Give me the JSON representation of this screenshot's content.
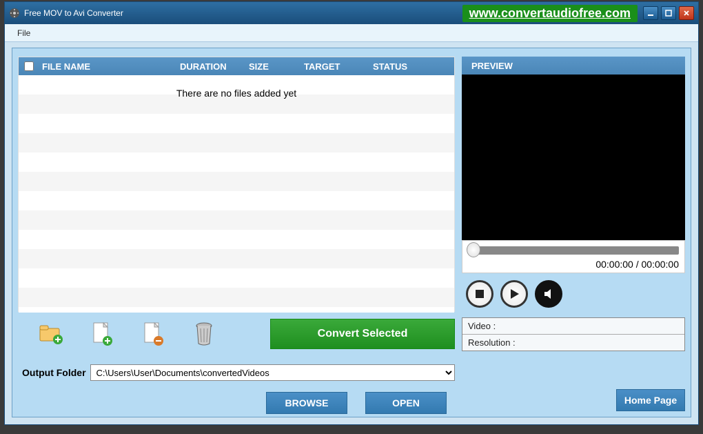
{
  "window": {
    "title": "Free MOV to Avi Converter",
    "promo": "www.convertaudiofree.com"
  },
  "menubar": {
    "file": "File"
  },
  "table": {
    "headers": {
      "name": "FILE NAME",
      "duration": "DURATION",
      "size": "SIZE",
      "target": "TARGET",
      "status": "STATUS"
    },
    "empty": "There are no files added yet"
  },
  "toolbar": {
    "convert": "Convert Selected"
  },
  "output": {
    "label": "Output Folder",
    "path": "C:\\Users\\User\\Documents\\convertedVideos"
  },
  "buttons": {
    "browse": "BROWSE",
    "open": "OPEN",
    "home": "Home Page"
  },
  "preview": {
    "header": "PREVIEW",
    "time_current": "00:00:00",
    "time_sep": " / ",
    "time_total": "00:00:00",
    "video_label": "Video :",
    "resolution_label": "Resolution :"
  }
}
